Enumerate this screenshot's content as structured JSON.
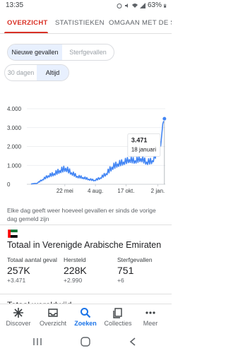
{
  "status_bar": {
    "time": "13:35",
    "battery": "63%"
  },
  "tabs": [
    {
      "label": "OVERZICHT",
      "active": true
    },
    {
      "label": "STATISTIEKEN",
      "active": false
    },
    {
      "label": "OMGAAN MET DE SIT",
      "active": false
    }
  ],
  "filters": {
    "metric": [
      {
        "label": "Nieuwe gevallen",
        "selected": true
      },
      {
        "label": "Sterfgevallen",
        "selected": false
      }
    ],
    "range": [
      {
        "label": "30 dagen",
        "selected": false
      },
      {
        "label": "Altijd",
        "selected": true
      }
    ]
  },
  "chart_data": {
    "type": "line",
    "x_ticks": [
      "22 mei",
      "4 aug.",
      "17 okt.",
      "2 jan."
    ],
    "y_ticks": [
      "0",
      "1.000",
      "2.000",
      "3.000",
      "4.000"
    ],
    "ylim": [
      0,
      4300
    ],
    "grid": true,
    "color": "#4285f4",
    "x": [
      "2020-03-01",
      "2020-03-15",
      "2020-03-29",
      "2020-04-12",
      "2020-04-26",
      "2020-05-10",
      "2020-05-24",
      "2020-06-07",
      "2020-06-21",
      "2020-07-05",
      "2020-07-19",
      "2020-08-02",
      "2020-08-16",
      "2020-08-30",
      "2020-09-13",
      "2020-09-27",
      "2020-10-11",
      "2020-10-25",
      "2020-11-08",
      "2020-11-22",
      "2020-12-06",
      "2020-12-20",
      "2021-01-03",
      "2021-01-10",
      "2021-01-14",
      "2021-01-18"
    ],
    "values": [
      20,
      50,
      250,
      450,
      560,
      730,
      850,
      610,
      420,
      360,
      270,
      210,
      340,
      560,
      910,
      1080,
      1180,
      1310,
      1250,
      1370,
      1180,
      1250,
      1800,
      2250,
      3200,
      3471
    ],
    "tooltip": {
      "value": "3.471",
      "date": "18 januari"
    }
  },
  "caption": "Elke dag geeft weer hoeveel gevallen er sinds de vorige dag gemeld zijn",
  "region": {
    "title": "Totaal in Verenigde Arabische Emiraten",
    "stats": [
      {
        "label": "Totaal aantal geval",
        "value": "257K",
        "delta": "+3.471"
      },
      {
        "label": "Hersteld",
        "value": "228K",
        "delta": "+2.990"
      },
      {
        "label": "Sterfgevallen",
        "value": "751",
        "delta": "+6"
      }
    ]
  },
  "world_title": "Totaal wereldwijd",
  "bottom_nav": [
    {
      "label": "Discover",
      "icon": "asterisk-icon",
      "active": false
    },
    {
      "label": "Overzicht",
      "icon": "inbox-icon",
      "active": false
    },
    {
      "label": "Zoeken",
      "icon": "search-icon",
      "active": true
    },
    {
      "label": "Collecties",
      "icon": "collections-icon",
      "active": false
    },
    {
      "label": "Meer",
      "icon": "more-dots-icon",
      "active": false
    }
  ],
  "colors": {
    "accent_red": "#d93025",
    "accent_blue": "#1a73e8",
    "chart_line": "#4285f4"
  }
}
